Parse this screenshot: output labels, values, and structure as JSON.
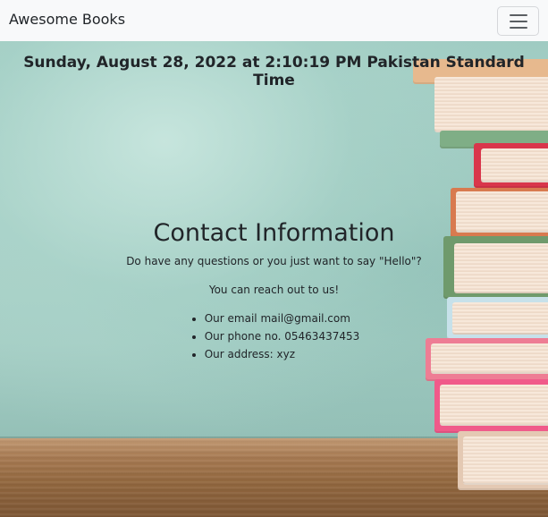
{
  "navbar": {
    "brand": "Awesome Books",
    "toggler_icon": "hamburger-menu-icon"
  },
  "datetime": "Sunday, August 28, 2022 at 2:10:19 PM Pakistan Standard Time",
  "contact": {
    "title": "Contact Information",
    "question": "Do have any questions or you just want to say \"Hello\"?",
    "reach": "You can reach out to us!",
    "items": [
      "Our email mail@gmail.com",
      "Our phone no. 05463437453",
      "Our address: xyz"
    ]
  },
  "colors": {
    "navbar_bg": "#f8f9fa",
    "text": "#212529",
    "wall": "#a9d0c7",
    "table": "#93683f"
  }
}
